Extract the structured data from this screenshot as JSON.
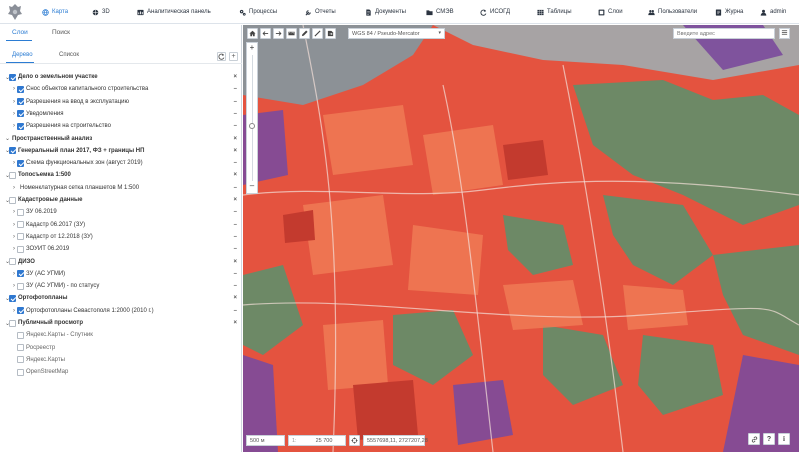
{
  "topnav": {
    "items": [
      {
        "label": "Карта",
        "icon": "globe-icon",
        "active": true
      },
      {
        "label": "3D",
        "icon": "globe-icon"
      },
      {
        "label": "Аналитическая панель",
        "icon": "dashboard-icon"
      },
      {
        "label": "Процессы",
        "icon": "gears-icon"
      },
      {
        "label": "Отчеты",
        "icon": "wrench-icon"
      },
      {
        "label": "Документы",
        "icon": "document-icon"
      },
      {
        "label": "СМЭВ",
        "icon": "folder-icon"
      },
      {
        "label": "ИСОГД",
        "icon": "refresh-icon"
      },
      {
        "label": "Таблицы",
        "icon": "table-icon"
      },
      {
        "label": "Слои",
        "icon": "layers-icon"
      },
      {
        "label": "Пользователи",
        "icon": "users-icon"
      },
      {
        "label": "Журна",
        "icon": "journal-icon"
      },
      {
        "label": "admin",
        "icon": "user-icon"
      }
    ]
  },
  "sidebar": {
    "tabs": [
      "Слои",
      "Поиск"
    ],
    "subtabs": [
      "Дерево",
      "Список"
    ],
    "tree": [
      {
        "level": 0,
        "label": "Дело о земельном участке",
        "bold": true,
        "checked": true,
        "action": "×"
      },
      {
        "level": 1,
        "label": "Снос объектов капитального строительства",
        "checked": true,
        "action": "–"
      },
      {
        "level": 1,
        "label": "Разрешения на ввод в эксплуатацию",
        "checked": true,
        "action": "–"
      },
      {
        "level": 1,
        "label": "Уведомления",
        "checked": true,
        "action": "–"
      },
      {
        "level": 1,
        "label": "Разрешения на строительство",
        "checked": true,
        "action": "–"
      },
      {
        "level": 0,
        "label": "Пространственный анализ",
        "bold": true,
        "checked": null,
        "action": "×"
      },
      {
        "level": 0,
        "label": "Генеральный план 2017, ФЗ + границы НП",
        "bold": true,
        "checked": true,
        "action": "×"
      },
      {
        "level": 1,
        "label": "Схема функциональных зон (август 2019)",
        "checked": true,
        "action": "–"
      },
      {
        "level": 0,
        "label": "Топосъемка 1:500",
        "bold": true,
        "checked": false,
        "action": "×"
      },
      {
        "level": 1,
        "label": "Номенклатурная сетка планшетов М 1:500",
        "checked": null,
        "action": "–"
      },
      {
        "level": 0,
        "label": "Кадастровые данные",
        "bold": true,
        "checked": false,
        "action": "×"
      },
      {
        "level": 1,
        "label": "ЗУ 06.2019",
        "checked": false,
        "action": "–"
      },
      {
        "level": 1,
        "label": "Кадастр 06.2017 (ЗУ)",
        "checked": false,
        "action": "–"
      },
      {
        "level": 1,
        "label": "Кадастр от 12.2018 (ЗУ)",
        "checked": false,
        "action": "–"
      },
      {
        "level": 1,
        "label": "ЗОУИТ 06.2019",
        "checked": false,
        "action": "–"
      },
      {
        "level": 0,
        "label": "ДИЗО",
        "bold": true,
        "checked": false,
        "action": "×"
      },
      {
        "level": 1,
        "label": "ЗУ (АС УГМИ)",
        "checked": true,
        "action": "–"
      },
      {
        "level": 1,
        "label": "ЗУ (АС УГМИ) - по статусу",
        "checked": false,
        "action": "–"
      },
      {
        "level": 0,
        "label": "Ортофотопланы",
        "bold": true,
        "checked": true,
        "action": "×"
      },
      {
        "level": 1,
        "label": "Ортофотопланы Севастополя 1:2000 (2010 г.)",
        "checked": true,
        "action": "–"
      },
      {
        "level": 0,
        "label": "Публичный просмотр",
        "bold": true,
        "checked": false,
        "action": "×"
      },
      {
        "level": 1,
        "label": "Яндекс.Карты - Спутник",
        "checked": false,
        "muted": true
      },
      {
        "level": 1,
        "label": "Росреестр",
        "checked": false,
        "muted": true
      },
      {
        "level": 1,
        "label": "Яндекс.Карты",
        "checked": false,
        "muted": true
      },
      {
        "level": 1,
        "label": "OpenStreetMap",
        "checked": false,
        "muted": true
      }
    ]
  },
  "map": {
    "projection": "WGS 84 / Pseudo-Mercator",
    "address_placeholder": "Введите адрес",
    "scale_bar": "500 м",
    "scale_prefix": "1:",
    "scale_value": "25 700",
    "coords": "5557698,11, 2727207,28"
  },
  "colors": {
    "accent": "#2b7cd3",
    "zone_residential": "#e4533f",
    "zone_green": "#5f8f6a",
    "zone_purple": "#7b4a9c",
    "zone_gray": "#a7a3a4"
  }
}
